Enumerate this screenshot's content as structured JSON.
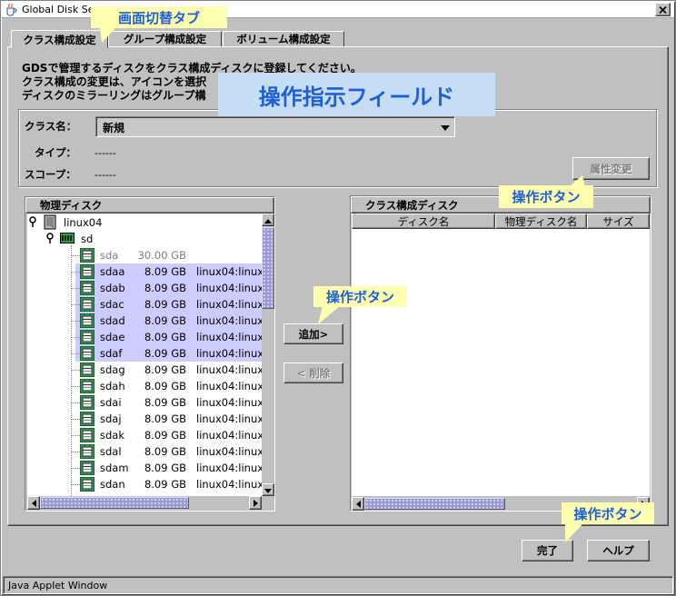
{
  "window": {
    "title": "Global Disk Se",
    "status": "Java Applet Window"
  },
  "colors": {
    "callout_text": "#1f5fd6",
    "callout_bg": "#ffffb0",
    "overlay_bg": "#c6ddf6",
    "selection_bg": "#ccccff",
    "scroll_thumb": "#9c9ccc",
    "window_bg": "#c0c0c0"
  },
  "icons": {
    "window": "java-cup-icon",
    "close": "close-icon",
    "combo": "chevron-down-icon",
    "tree_handle": "tree-handle-icon",
    "host": "server-icon",
    "disk_group": "disk-array-icon",
    "disk": "disk-icon"
  },
  "callouts": {
    "tabs": "画面切替タブ",
    "instruction_field": "操作指示フィールド",
    "attr_button": "操作ボタン",
    "add_button": "操作ボタン",
    "finish_button": "操作ボタン"
  },
  "tabs": [
    {
      "label": "クラス構成設定",
      "selected": true
    },
    {
      "label": "グループ構成設定",
      "selected": false
    },
    {
      "label": "ボリューム構成設定",
      "selected": false
    }
  ],
  "instructions": [
    "GDSで管理するディスクをクラス構成ディスクに登録してください。",
    "クラス構成の変更は、アイコンを選択",
    "ディスクのミラーリングはグループ構"
  ],
  "class_form": {
    "name_label": "クラス名：",
    "name_value": "新規",
    "type_label": "タイプ：",
    "type_value": "------",
    "scope_label": "スコープ：",
    "scope_value": "------",
    "attr_button": "属性変更"
  },
  "physical_disks": {
    "title": "物理ディスク",
    "host": "linux04",
    "group": "sd",
    "items": [
      {
        "name": "sda",
        "size": "30.00 GB",
        "host": "",
        "selected": false,
        "unavailable": true
      },
      {
        "name": "sdaa",
        "size": "8.09 GB",
        "host": "linux04:linux0",
        "selected": true,
        "unavailable": false
      },
      {
        "name": "sdab",
        "size": "8.09 GB",
        "host": "linux04:linux0",
        "selected": true,
        "unavailable": false
      },
      {
        "name": "sdac",
        "size": "8.09 GB",
        "host": "linux04:linux0",
        "selected": true,
        "unavailable": false
      },
      {
        "name": "sdad",
        "size": "8.09 GB",
        "host": "linux04:linux0",
        "selected": true,
        "unavailable": false
      },
      {
        "name": "sdae",
        "size": "8.09 GB",
        "host": "linux04:linux0",
        "selected": true,
        "unavailable": false
      },
      {
        "name": "sdaf",
        "size": "8.09 GB",
        "host": "linux04:linux0",
        "selected": true,
        "unavailable": false
      },
      {
        "name": "sdag",
        "size": "8.09 GB",
        "host": "linux04:linux0",
        "selected": false,
        "unavailable": false
      },
      {
        "name": "sdah",
        "size": "8.09 GB",
        "host": "linux04:linux0",
        "selected": false,
        "unavailable": false
      },
      {
        "name": "sdai",
        "size": "8.09 GB",
        "host": "linux04:linux0",
        "selected": false,
        "unavailable": false
      },
      {
        "name": "sdaj",
        "size": "8.09 GB",
        "host": "linux04:linux0",
        "selected": false,
        "unavailable": false
      },
      {
        "name": "sdak",
        "size": "8.09 GB",
        "host": "linux04:linux0",
        "selected": false,
        "unavailable": false
      },
      {
        "name": "sdal",
        "size": "8.09 GB",
        "host": "linux04:linux0",
        "selected": false,
        "unavailable": false
      },
      {
        "name": "sdam",
        "size": "8.09 GB",
        "host": "linux04:linux",
        "selected": false,
        "unavailable": false
      },
      {
        "name": "sdan",
        "size": "8.09 GB",
        "host": "linux04:linux0",
        "selected": false,
        "unavailable": false
      }
    ]
  },
  "transfer": {
    "add_label": "追加>",
    "remove_label": "< 削除"
  },
  "class_disks": {
    "title": "クラス構成ディスク",
    "columns": [
      "ディスク名",
      "物理ディスク名",
      "サイズ"
    ],
    "rows": []
  },
  "footer": {
    "finish_label": "完了",
    "help_label": "ヘルプ"
  }
}
